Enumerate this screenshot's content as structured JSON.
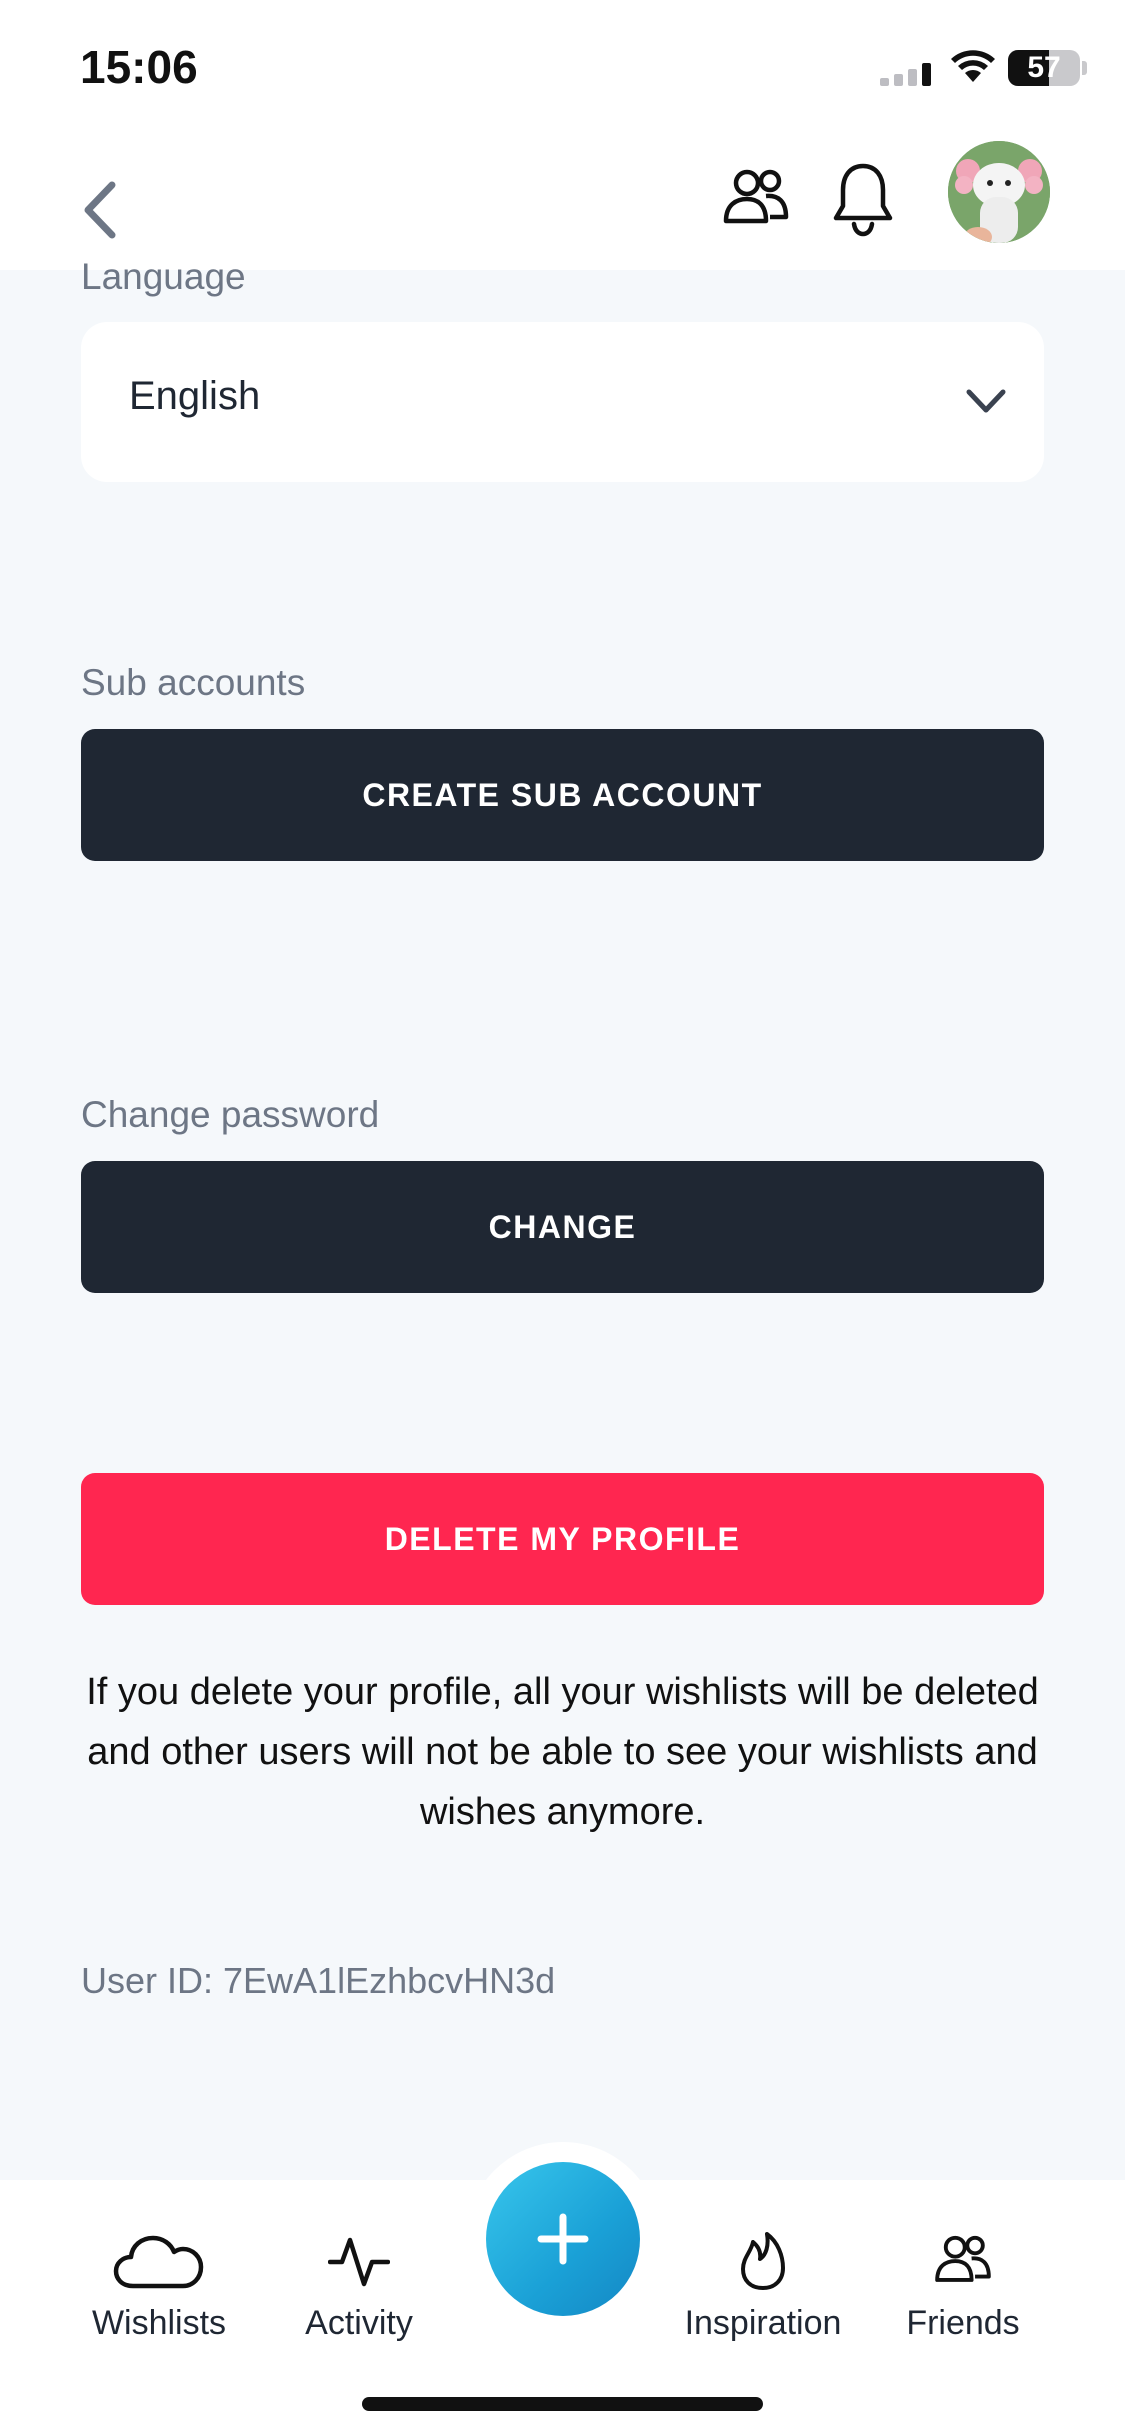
{
  "status_bar": {
    "time": "15:06",
    "battery_percent": "57",
    "battery_level": 0.57
  },
  "top_nav": {
    "icons": [
      "chevron-left-icon",
      "friends-icon",
      "bell-icon",
      "avatar"
    ]
  },
  "settings": {
    "language": {
      "label": "Language",
      "value": "English"
    },
    "sub_accounts": {
      "label": "Sub accounts",
      "button": "CREATE SUB ACCOUNT"
    },
    "change_password": {
      "label": "Change password",
      "button": "CHANGE"
    },
    "delete_profile": {
      "button": "DELETE MY PROFILE",
      "warning": "If you delete your profile, all your wishlists will be deleted and other users will not be able to see your wishlists and wishes anymore."
    },
    "user_id": "User ID: 7EwA1lEzhbcvHN3d"
  },
  "tab_bar": {
    "items": [
      {
        "label": "Wishlists",
        "icon": "cloud-icon"
      },
      {
        "label": "Activity",
        "icon": "activity-icon"
      },
      {
        "label": "",
        "icon": "plus-icon"
      },
      {
        "label": "Inspiration",
        "icon": "flame-icon"
      },
      {
        "label": "Friends",
        "icon": "friends-icon"
      }
    ]
  },
  "colors": {
    "background": "#f5f8fb",
    "dark_button": "#1f2733",
    "danger_button": "#ff2650",
    "fab": "#1aa0d6",
    "muted_text": "#6d7685"
  }
}
